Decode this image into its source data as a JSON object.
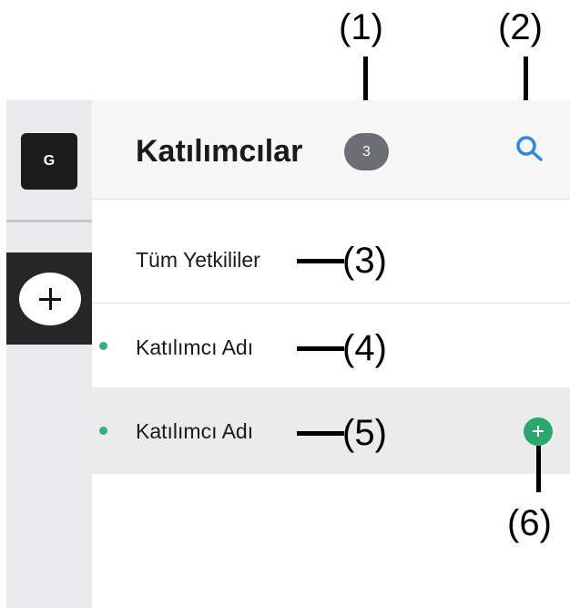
{
  "sidebar": {
    "avatar_letter": "G",
    "add_icon": "plus-icon"
  },
  "header": {
    "title": "Katılımcılar",
    "count": "3",
    "search_icon": "search-icon"
  },
  "list": {
    "all_label": "Tüm Yetkililer",
    "participants": [
      {
        "name": "Katılımcı Adı",
        "status": "online"
      },
      {
        "name": "Katılımcı Adı",
        "status": "online"
      }
    ],
    "add_participant_icon": "plus-icon"
  },
  "callouts": [
    "(1)",
    "(2)",
    "(3)",
    "(4)",
    "(5)",
    "(6)"
  ],
  "colors": {
    "online": "#2db37a",
    "accent": "#2b8ae0",
    "add_green": "#2aa66f"
  }
}
